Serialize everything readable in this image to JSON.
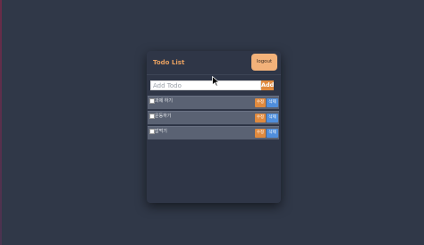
{
  "app": {
    "title": "Todo List",
    "logout_label": "logout"
  },
  "add_todo": {
    "placeholder": "Add Todo",
    "value": "",
    "button_label": "Add"
  },
  "todos": [
    {
      "label": "과제 하기",
      "checked": false,
      "edit_label": "수정",
      "delete_label": "삭제"
    },
    {
      "label": "운동하기",
      "checked": false,
      "edit_label": "수정",
      "delete_label": "삭제"
    },
    {
      "label": "밥먹기",
      "checked": false,
      "edit_label": "수정",
      "delete_label": "삭제"
    }
  ],
  "colors": {
    "background": "#303848",
    "card": "#2f3647",
    "accent_orange": "#e08a3e",
    "logout_button": "#f3b27a",
    "delete_blue": "#4f8edc",
    "item_row": "#5a6273",
    "title_text": "#e8a060"
  }
}
